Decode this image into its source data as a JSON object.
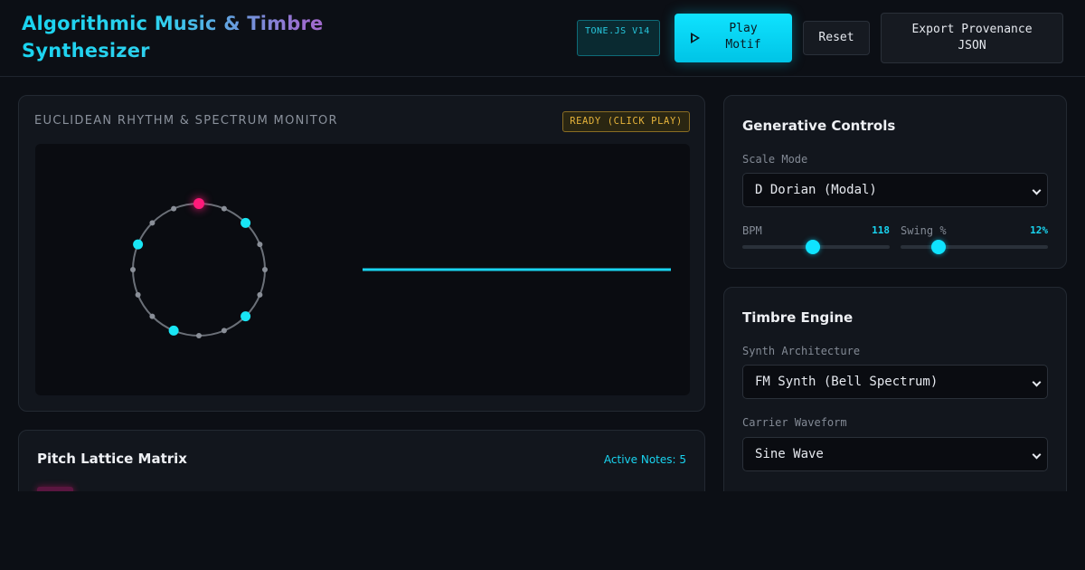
{
  "header": {
    "title": "Algorithmic Music & Timbre Synthesizer",
    "badge": "TONE.JS V14",
    "play_label": "Play Motif",
    "reset_label": "Reset",
    "export_label": "Export Provenance JSON"
  },
  "monitor": {
    "title": "EUCLIDEAN RHYTHM & SPECTRUM MONITOR",
    "status": "READY (CLICK PLAY)",
    "steps": 16,
    "active_steps": [
      0,
      2,
      6,
      9,
      13
    ],
    "playhead_step": 0,
    "colors": {
      "active": "#19e6f5",
      "playhead": "#ff1a7a",
      "inactive": "#8a8f98",
      "ring": "#6b7078",
      "spectrum": "#19d4f0"
    }
  },
  "lattice": {
    "title": "Pitch Lattice Matrix",
    "active_notes": "Active Notes: 5"
  },
  "generative": {
    "title": "Generative Controls",
    "scale_label": "Scale Mode",
    "scale_value": "D Dorian (Modal)",
    "bpm_label": "BPM",
    "bpm_value": "118",
    "bpm_fraction": 0.48,
    "swing_label": "Swing %",
    "swing_value": "12%",
    "swing_fraction": 0.26
  },
  "timbre": {
    "title": "Timbre Engine",
    "synth_label": "Synth Architecture",
    "synth_value": "FM Synth (Bell Spectrum)",
    "wave_label": "Carrier Waveform",
    "wave_value": "Sine Wave"
  }
}
